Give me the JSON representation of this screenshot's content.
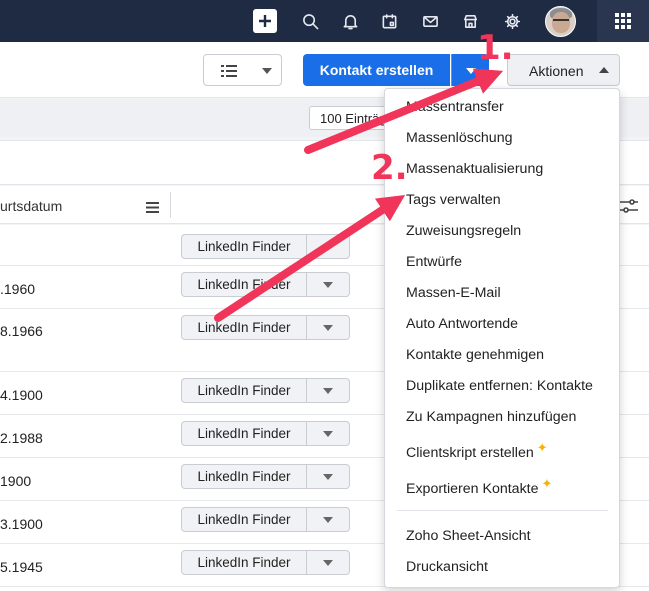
{
  "topbar": {
    "icons": [
      "plus-icon",
      "search-icon",
      "bell-icon",
      "calendar-icon",
      "mail-icon",
      "store-icon",
      "gear-icon",
      "avatar",
      "apps-grid-icon"
    ]
  },
  "toolbar": {
    "create_label": "Kontakt erstellen",
    "actions_label": "Aktionen"
  },
  "paging": {
    "records_per_page": "100 Einträge"
  },
  "table": {
    "column_header": "urtsdatum",
    "rows": [
      {
        "date": "",
        "button": "LinkedIn Finder"
      },
      {
        "date": ".1960",
        "button": "LinkedIn Finder"
      },
      {
        "date": "8.1966",
        "button": "LinkedIn Finder"
      },
      {
        "date": "4.1900",
        "button": "LinkedIn Finder"
      },
      {
        "date": "2.1988",
        "button": "LinkedIn Finder"
      },
      {
        "date": "1900",
        "button": "LinkedIn Finder"
      },
      {
        "date": "3.1900",
        "button": "LinkedIn Finder"
      },
      {
        "date": "5.1945",
        "button": "LinkedIn Finder"
      }
    ]
  },
  "menu": {
    "items": [
      "Massentransfer",
      "Massenlöschung",
      "Massenaktualisierung",
      "Tags verwalten",
      "Zuweisungsregeln",
      "Entwürfe",
      "Massen-E-Mail",
      "Auto Antwortende",
      "Kontakte genehmigen",
      "Duplikate entfernen: Kontakte",
      "Zu Kampagnen hinzufügen",
      "Clientskript erstellen",
      "Exportieren Kontakte",
      "Zoho Sheet-Ansicht",
      "Druckansicht"
    ]
  },
  "annotations": {
    "step1": "1.",
    "step2": "2.",
    "color": "#f0345a"
  }
}
